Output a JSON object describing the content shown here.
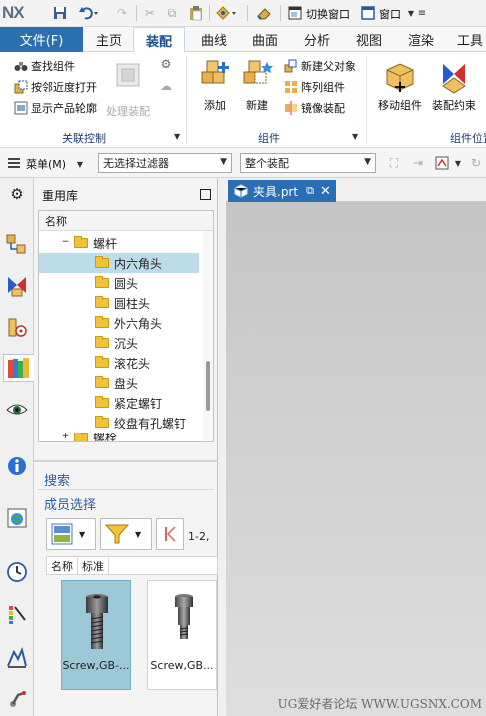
{
  "app": {
    "logo": "NX"
  },
  "quickbar": {
    "switch_window": "切换窗口",
    "window": "窗口"
  },
  "ribbon": {
    "file_tab": "文件(F)",
    "tabs": [
      "主页",
      "装配",
      "曲线",
      "曲面",
      "分析",
      "视图",
      "渲染",
      "工具"
    ],
    "active_tab": "装配",
    "assoc": {
      "find_component": "查找组件",
      "open_by_proximity": "按邻近度打开",
      "show_product_outline": "显示产品轮廓",
      "wave_assembly": "处理装配",
      "group_label": "关联控制"
    },
    "components": {
      "add": "添加",
      "new": "新建",
      "new_parent": "新建父对象",
      "array": "阵列组件",
      "mirror": "镜像装配",
      "group_label": "组件"
    },
    "position": {
      "move": "移动组件",
      "constraint": "装配约束",
      "group_label": "组件位置"
    }
  },
  "selbar": {
    "menu": "菜单(M)",
    "filter": "无选择过滤器",
    "scope": "整个装配"
  },
  "reuse_library": {
    "title": "重用库",
    "tree_header": "名称",
    "tree": [
      {
        "label": "螺杆",
        "level": 1,
        "expanded": true
      },
      {
        "label": "内六角头",
        "level": 2,
        "selected": true
      },
      {
        "label": "圆头",
        "level": 2
      },
      {
        "label": "圆柱头",
        "level": 2
      },
      {
        "label": "外六角头",
        "level": 2
      },
      {
        "label": "沉头",
        "level": 2
      },
      {
        "label": "滚花头",
        "level": 2
      },
      {
        "label": "盘头",
        "level": 2
      },
      {
        "label": "紧定螺钉",
        "level": 2
      },
      {
        "label": "绞盘有孔螺钉",
        "level": 2
      },
      {
        "label": "螺栓",
        "level": 1,
        "expanded": false
      }
    ],
    "search": "搜索",
    "member_select": "成员选择",
    "range": "1-2,",
    "columns": [
      "名称",
      "标准"
    ],
    "members": [
      {
        "label": "Screw,GB-...",
        "selected": true
      },
      {
        "label": "Screw,GB..."
      }
    ]
  },
  "graphics": {
    "doc_tab": "夹具.prt",
    "watermark": "UG爱好者论坛 WWW.UGSNX.COM"
  },
  "colors": {
    "file_tab": "#2c6fb0",
    "doc_tab": "#2a6fb5",
    "selection": "#bcdcea",
    "link": "#2a5fa0"
  }
}
